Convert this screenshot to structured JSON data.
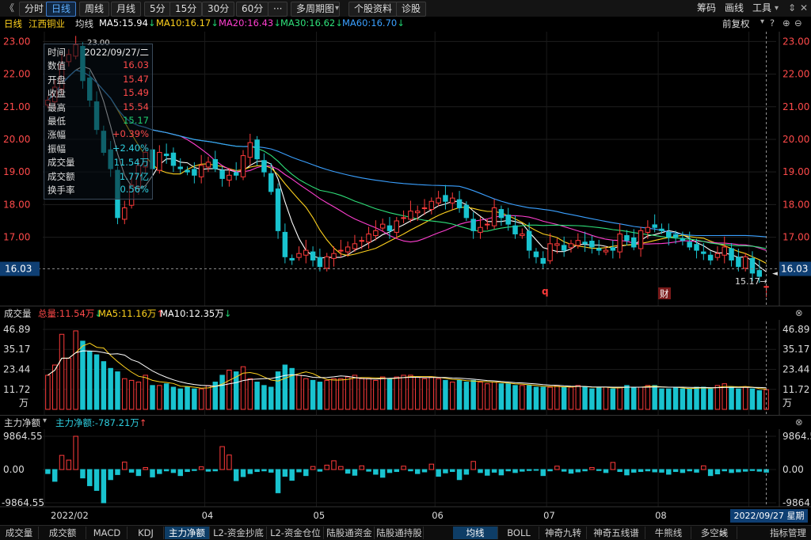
{
  "toolbar": {
    "back": "《",
    "tabs": [
      "分时",
      "日线",
      "周线",
      "月线",
      "5分",
      "15分",
      "30分",
      "60分",
      "···",
      "多周期图",
      "个股资料",
      "诊股"
    ],
    "active_tab": "日线",
    "right": [
      "筹码",
      "画线",
      "工具"
    ]
  },
  "ma_bar": {
    "period": "日线",
    "stock_name": "江西铜业",
    "avg_label": "均线",
    "items": [
      {
        "text": "MA5:15.94",
        "arrow": "↓",
        "color": "#ffffff",
        "arrow_color": "#1fcf6f"
      },
      {
        "text": "MA10:16.17",
        "arrow": "↓",
        "color": "#ffd21e",
        "arrow_color": "#1fcf6f"
      },
      {
        "text": "MA20:16.43",
        "arrow": "↓",
        "color": "#ff3fd0",
        "arrow_color": "#1fcf6f"
      },
      {
        "text": "MA30:16.62",
        "arrow": "↓",
        "color": "#2fe07a",
        "arrow_color": "#1fcf6f"
      },
      {
        "text": "MA60:16.70",
        "arrow": "↓",
        "color": "#3aa0ff",
        "arrow_color": "#1fcf6f"
      }
    ],
    "adjust": "前复权"
  },
  "tooltip": {
    "rows": [
      {
        "k": "时间",
        "v": "2022/09/27/二",
        "c": "#e8e8e8"
      },
      {
        "k": "数值",
        "v": "16.03",
        "c": "#ff4a4a"
      },
      {
        "k": "开盘",
        "v": "15.47",
        "c": "#ff4a4a"
      },
      {
        "k": "收盘",
        "v": "15.49",
        "c": "#ff4a4a"
      },
      {
        "k": "最高",
        "v": "15.54",
        "c": "#ff4a4a"
      },
      {
        "k": "最低",
        "v": "15.17",
        "c": "#1fcf6f"
      },
      {
        "k": "涨幅",
        "v": "+0.39%",
        "c": "#ff4a4a"
      },
      {
        "k": "振幅",
        "v": "+2.40%",
        "c": "#2fcfe0"
      },
      {
        "k": "成交量",
        "v": "11.54万",
        "c": "#2fcfe0"
      },
      {
        "k": "成交额",
        "v": "1.77亿",
        "c": "#2fcfe0"
      },
      {
        "k": "换手率",
        "v": "0.56%",
        "c": "#2fcfe0"
      }
    ]
  },
  "markers": {
    "q": "q",
    "cai": "财",
    "high": "23.00",
    "low_note": "15.17→",
    "cursor_price": "16.03"
  },
  "volume_bar": {
    "title": "成交量",
    "items": [
      {
        "text": "总量:11.54万",
        "arrow": "↓",
        "color": "#ff4a4a",
        "arrow_color": "#1fcf6f"
      },
      {
        "text": "MA5:11.16万",
        "arrow": "↑",
        "color": "#ffd21e",
        "arrow_color": "#ff4a4a"
      },
      {
        "text": "MA10:12.35万",
        "arrow": "↓",
        "color": "#ffffff",
        "arrow_color": "#1fcf6f"
      }
    ],
    "unit": "万"
  },
  "flow_bar": {
    "title": "主力净额",
    "item": {
      "text": "主力净额:-787.21万",
      "arrow": "↑",
      "color": "#2fcfe0",
      "arrow_color": "#ff4a4a"
    }
  },
  "date_info": "2022/09/27 星期二",
  "bottom_tabs": {
    "left": [
      "成交量",
      "成交额",
      "MACD",
      "KDJ",
      "主力净额",
      "L2-资金抄底",
      "L2-资金仓位",
      "陆股通资金",
      "陆股通持股"
    ],
    "left_active": "主力净额",
    "right": [
      "均线",
      "BOLL",
      "神奇九转",
      "神奇五线谱",
      "牛熊线",
      "多空线"
    ],
    "right_active": "均线",
    "more": ">",
    "manage": "指标管理"
  },
  "chart_data": [
    {
      "type": "candlestick",
      "title": "江西铜业 日线",
      "x_tick_labels": [
        "2022/02",
        "04",
        "05",
        "06",
        "07",
        "08",
        "09"
      ],
      "ylim": [
        15.0,
        23.3
      ],
      "y_ticks": [
        "23.00",
        "22.00",
        "21.00",
        "20.00",
        "19.00",
        "18.00",
        "17.00",
        "16.03"
      ],
      "series_names": [
        "MA5",
        "MA10",
        "MA20",
        "MA30",
        "MA60"
      ],
      "close": [
        21.2,
        21.6,
        22.3,
        22.6,
        22.9,
        21.8,
        21.2,
        20.3,
        19.6,
        19.1,
        17.6,
        17.9,
        18.6,
        19.2,
        19.6,
        19.1,
        19.6,
        19.5,
        19.2,
        19.1,
        19.0,
        18.9,
        19.2,
        19.3,
        19.1,
        18.8,
        18.9,
        18.9,
        19.5,
        19.9,
        19.4,
        19.0,
        18.4,
        17.2,
        16.4,
        16.3,
        16.5,
        16.6,
        16.3,
        16.1,
        16.4,
        16.5,
        16.6,
        16.7,
        16.8,
        16.9,
        17.1,
        17.2,
        17.4,
        17.2,
        17.5,
        17.6,
        17.8,
        17.8,
        17.9,
        18.1,
        18.2,
        18.1,
        18.2,
        17.9,
        17.6,
        17.2,
        17.3,
        17.4,
        17.9,
        17.6,
        17.4,
        17.1,
        17.1,
        16.6,
        16.4,
        16.2,
        16.8,
        16.8,
        16.6,
        16.8,
        16.9,
        16.8,
        16.7,
        16.6,
        16.6,
        16.6,
        17.1,
        16.9,
        16.7,
        17.2,
        17.3,
        17.3,
        17.2,
        17.0,
        17.0,
        16.9,
        16.7,
        16.6,
        16.5,
        16.3,
        16.5,
        16.7,
        16.3,
        16.1,
        16.4,
        15.9,
        15.8,
        15.49
      ],
      "volume_wan": [
        20,
        26,
        44,
        30,
        46,
        40,
        34,
        32,
        28,
        24,
        22,
        18,
        17,
        16,
        20,
        14,
        14,
        15,
        13,
        12,
        13,
        12,
        12,
        14,
        16,
        20,
        23,
        22,
        25,
        18,
        16,
        14,
        13,
        22,
        26,
        24,
        20,
        18,
        17,
        16,
        17,
        18,
        18,
        19,
        20,
        18,
        18,
        17,
        19,
        18,
        19,
        20,
        20,
        19,
        18,
        19,
        18,
        17,
        16,
        17,
        16,
        17,
        16,
        15,
        16,
        15,
        15,
        14,
        14,
        14,
        13,
        13,
        13,
        14,
        13,
        13,
        14,
        13,
        12,
        13,
        13,
        12,
        13,
        14,
        13,
        13,
        14,
        14,
        12,
        12,
        13,
        12,
        12,
        13,
        13,
        12,
        14,
        15,
        13,
        12,
        13,
        12,
        11,
        11.54
      ],
      "ma5_volume": "11.16万",
      "ma10_volume": "12.35万",
      "volume_ticks": [
        "46.89",
        "35.17",
        "23.44",
        "11.72",
        "万"
      ],
      "main_net_wan": [
        -1200,
        -3500,
        4200,
        2800,
        9864,
        -2500,
        -4800,
        -6200,
        -9864,
        -3000,
        -1500,
        2200,
        -800,
        -1800,
        600,
        -2200,
        -1200,
        -400,
        -900,
        -1800,
        -600,
        -300,
        800,
        -500,
        -400,
        6800,
        4300,
        -3300,
        -2100,
        -1200,
        -600,
        -400,
        -800,
        -6900,
        -2000,
        -3200,
        -700,
        -1800,
        900,
        -500,
        1300,
        2600,
        900,
        -1100,
        -1700,
        1100,
        -500,
        -1400,
        -2300,
        -900,
        -600,
        1000,
        -400,
        -1200,
        -700,
        1600,
        -2000,
        -1000,
        -600,
        -3000,
        -1400,
        2400,
        -900,
        -1700,
        -800,
        -1600,
        -400,
        -900,
        -500,
        -300,
        -200,
        -1800,
        -400,
        1000,
        -500,
        -1100,
        -700,
        -400,
        600,
        -300,
        -900,
        2100,
        -600,
        -1600,
        -800,
        -600,
        -400,
        -700,
        -800,
        -1400,
        -600,
        -900,
        -400,
        -800,
        1100,
        -1800,
        -1300,
        -400,
        -900,
        -700,
        -500,
        -300,
        -500,
        -787
      ],
      "flow_ticks": [
        "9864.55",
        "0.00",
        "-9864.55"
      ],
      "main_net_latest": "-787.21万"
    }
  ]
}
